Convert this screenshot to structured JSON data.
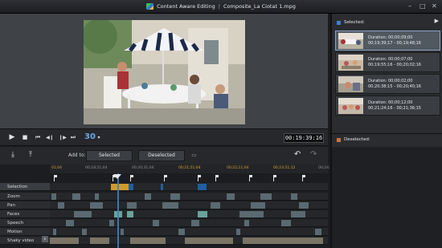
{
  "window": {
    "app_name": "Content Aware Editing",
    "separator": "|",
    "file_name": "Composite_La Ciotat 1.mpg",
    "min": "–",
    "max": "□",
    "close": "✕"
  },
  "player": {
    "timecode": "00:19:39:16",
    "fps_badge": "30",
    "scrub_position": 0.32,
    "icons": {
      "play": "▶",
      "stop": "■",
      "prev": "⏮",
      "step_back": "◀❙",
      "step_fwd": "❙▶",
      "next": "⏭",
      "volume": "🔈"
    }
  },
  "right_panel": {
    "selected_label": "Selected:",
    "deselected_label": "Deselected:",
    "play_icon": "▶",
    "clips": [
      {
        "duration": "Duration: 00;00;09;00",
        "range": "00;19;39;17 - 00;19;48;16",
        "active": true
      },
      {
        "duration": "Duration: 00;00;07;00",
        "range": "00;19;55;16 - 00;20;02;16",
        "active": false
      },
      {
        "duration": "Duration: 00;00;02;00",
        "range": "00;20;38;15 - 00;20;40;16",
        "active": false
      },
      {
        "duration": "Duration: 00;00;12;00",
        "range": "00;21;24;16 - 00;21;36;15",
        "active": false
      }
    ]
  },
  "toolbar": {
    "add_to": "Add to:",
    "selected_btn": "Selected",
    "deselected_btn": "Deselected",
    "undo_icon": "↶",
    "redo_icon": "↷",
    "link_icon": "⇔"
  },
  "timeline": {
    "ticks": [
      "01;04",
      "00;18;51;04",
      "00;20;31;04",
      "00;21;51;04",
      "00;22;11;04",
      "00;23;51;12",
      "00;24;"
    ],
    "tracks": [
      "Selection",
      "Zoom",
      "Pan",
      "Faces",
      "Speech",
      "Motion",
      "Shaky video"
    ]
  }
}
